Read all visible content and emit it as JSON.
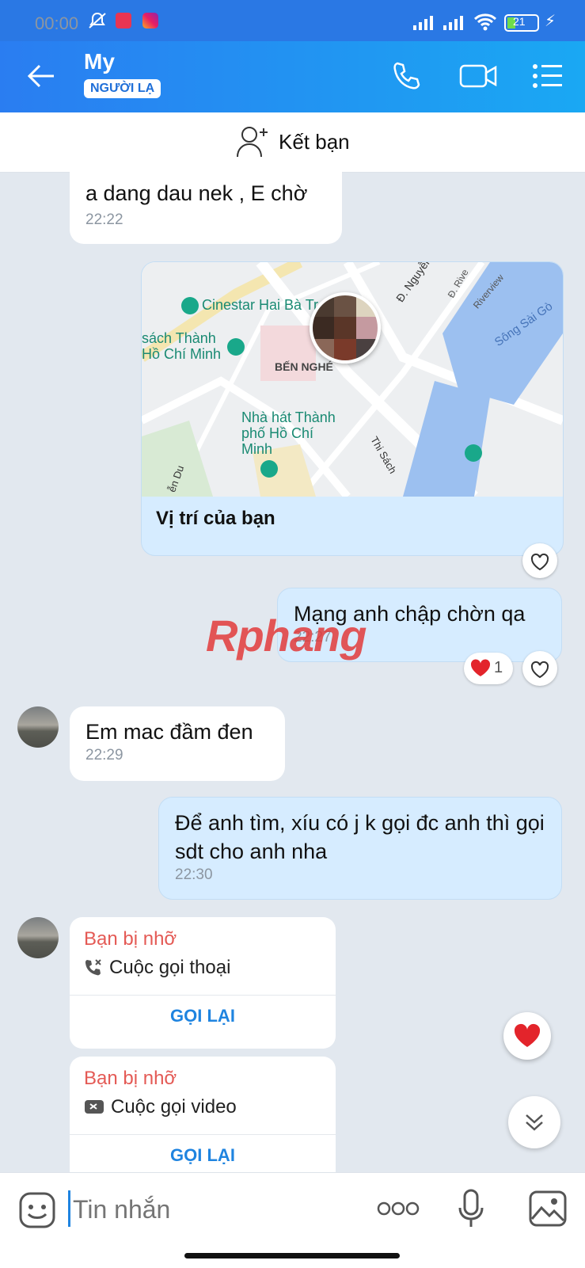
{
  "status_bar": {
    "time": "00:00",
    "battery": "21"
  },
  "header": {
    "contact_name": "My",
    "stranger_badge": "NGƯỜI LẠ"
  },
  "add_friend": {
    "label": "Kết bạn"
  },
  "messages": [
    {
      "direction": "in",
      "text": "a dang dau nek , E chờ",
      "time": "22:22"
    },
    {
      "direction": "out",
      "type": "location",
      "map_labels": {
        "cinema": "Cinestar Hai Bà Tr",
        "bookstreet": "sách Thành Hồ Chí Minh",
        "ward": "BẾN NGHÉ",
        "opera": "Nhà hát Thành phố Hồ Chí Minh",
        "street1": "Đ. Nguyễn Hu",
        "street2": "Thi Sách",
        "street3": "ễn Du",
        "river": "Sông Sài Gò",
        "road": "Riverview",
        "road2": "Đ. Rive"
      },
      "caption": "Vị trí của bạn"
    },
    {
      "direction": "out",
      "text": "Mạng anh chập chờn qa",
      "time": "22:27",
      "reaction_count": "1"
    },
    {
      "direction": "in",
      "text": "Em mac đầm đen",
      "time": "22:29"
    },
    {
      "direction": "out",
      "text": "Để anh tìm, xíu có j k gọi đc anh thì gọi sdt cho anh nha",
      "time": "22:30"
    }
  ],
  "missed_calls": [
    {
      "title": "Bạn bị nhỡ",
      "type": "Cuộc gọi thoại",
      "action": "GỌI LẠI"
    },
    {
      "title": "Bạn bị nhỡ",
      "type": "Cuộc gọi video",
      "action": "GỌI LẠI"
    }
  ],
  "watermark": "Rphang",
  "composer": {
    "placeholder": "Tin nhắn"
  },
  "colors": {
    "header_start": "#2a7df1",
    "header_end": "#1aa8f3",
    "out_bubble": "#d6ecff",
    "missed": "#e45a55",
    "callback": "#1f84e0",
    "heart": "#e3242b"
  }
}
